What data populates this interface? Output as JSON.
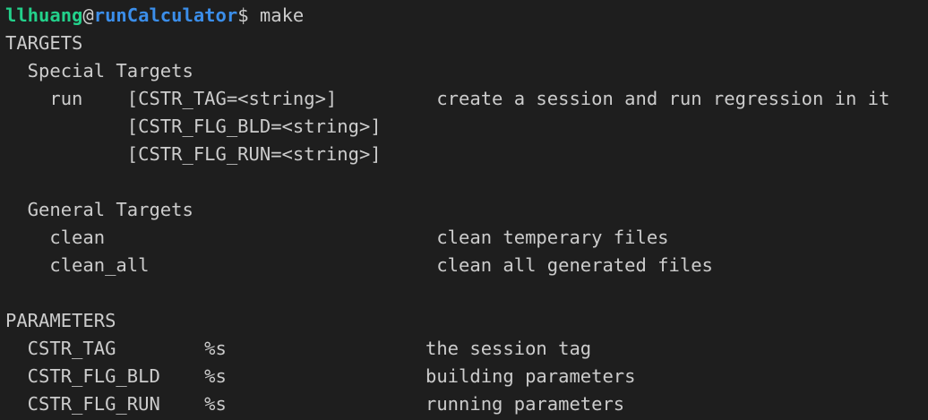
{
  "colors": {
    "background": "#1e1e1e",
    "foreground": "#cccccc",
    "user": "#23d18b",
    "host": "#3b8eea"
  },
  "prompt": {
    "user": "llhuang",
    "at": "@",
    "host": "runCalculator",
    "symbol": "$",
    "command": "make"
  },
  "lines": [
    "TARGETS",
    "  Special Targets",
    "    run    [CSTR_TAG=<string>]         create a session and run regression in it",
    "           [CSTR_FLG_BLD=<string>]",
    "           [CSTR_FLG_RUN=<string>]",
    "",
    "  General Targets",
    "    clean                              clean temperary files",
    "    clean_all                          clean all generated files",
    "",
    "PARAMETERS",
    "  CSTR_TAG        %s                  the session tag",
    "  CSTR_FLG_BLD    %s                  building parameters",
    "  CSTR_FLG_RUN    %s                  running parameters"
  ]
}
